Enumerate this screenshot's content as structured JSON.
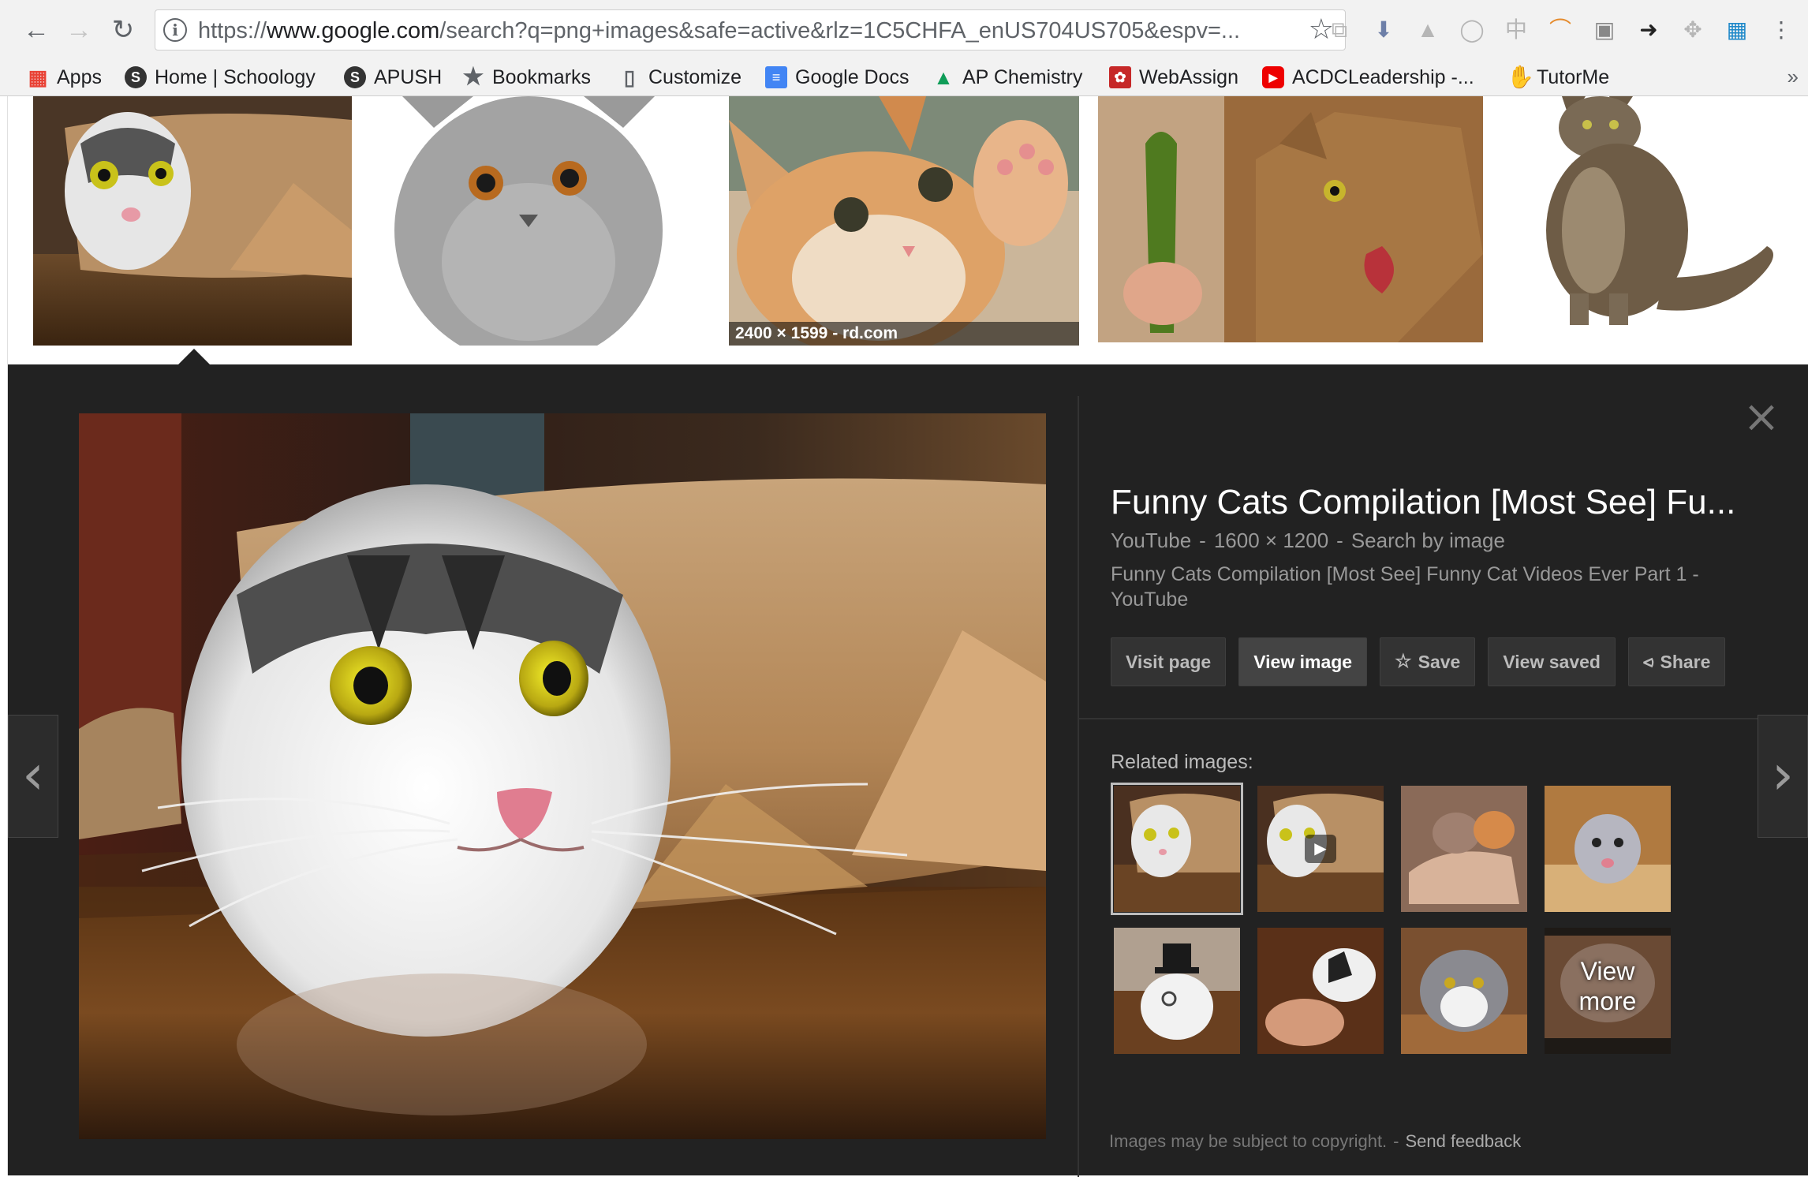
{
  "browser": {
    "url_prefix": "https://",
    "url_host": "www.google.com",
    "url_rest": "/search?q=png+images&safe=active&rlz=1C5CHFA_enUS704US705&espv=...",
    "bookmarks": [
      {
        "label": "Apps",
        "icon": "apps-grid-icon"
      },
      {
        "label": "Home | Schoology",
        "icon": "schoology-icon"
      },
      {
        "label": "APUSH",
        "icon": "schoology-icon"
      },
      {
        "label": "Bookmarks",
        "icon": "star-icon"
      },
      {
        "label": "Customize",
        "icon": "page-icon"
      },
      {
        "label": "Google Docs",
        "icon": "google-docs-icon"
      },
      {
        "label": "AP Chemistry",
        "icon": "google-drive-icon"
      },
      {
        "label": "WebAssign",
        "icon": "webassign-icon"
      },
      {
        "label": "ACDCLeadership -...",
        "icon": "youtube-icon"
      },
      {
        "label": "TutorMe",
        "icon": "tutorme-icon"
      }
    ]
  },
  "results_row": {
    "hover_caption": "2400 × 1599 - rd.com"
  },
  "viewer": {
    "title": "Funny Cats Compilation [Most See] Fu...",
    "source": "YouTube",
    "dimensions": "1600 × 1200",
    "search_by_image": "Search by image",
    "description": "Funny Cats Compilation [Most See] Funny Cat Videos Ever Part 1 - YouTube",
    "actions": {
      "visit_page": "Visit page",
      "view_image": "View image",
      "save": "Save",
      "view_saved": "View saved",
      "share": "Share"
    },
    "related_label": "Related images:",
    "view_more": "View more",
    "footer_copyright": "Images may be subject to copyright.",
    "footer_feedback": "Send feedback"
  },
  "colors": {
    "viewer_background": "#222222",
    "button_background": "#333333",
    "chrome_background": "#f2f2f2"
  }
}
